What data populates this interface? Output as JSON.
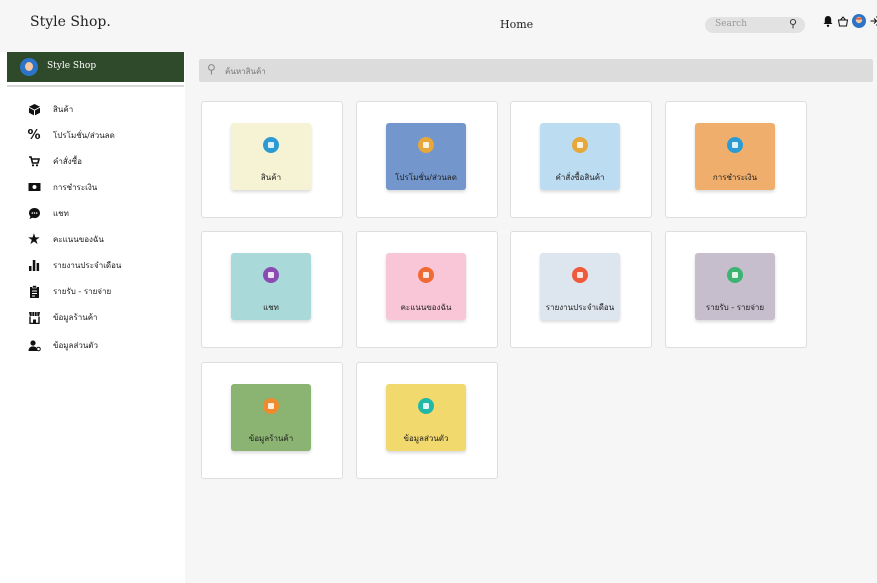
{
  "header": {
    "brand": "Style Shop.",
    "title": "Home",
    "search_placeholder": "Search"
  },
  "sidebar": {
    "title": "Style Shop",
    "items": [
      {
        "label": "สินค้า",
        "icon": "box-icon"
      },
      {
        "label": "โปรโมชั่น/ส่วนลด",
        "icon": "percent-icon"
      },
      {
        "label": "คำสั่งซื้อ",
        "icon": "cart-icon"
      },
      {
        "label": "การชำระเงิน",
        "icon": "money-icon"
      },
      {
        "label": "แชท",
        "icon": "chat-icon"
      },
      {
        "label": "คะแนนของฉัน",
        "icon": "star-icon"
      },
      {
        "label": "รายงานประจำเดือน",
        "icon": "bar-chart-icon"
      },
      {
        "label": "รายรับ - รายจ่าย",
        "icon": "clipboard-icon"
      },
      {
        "label": "ข้อมูลร้านค้า",
        "icon": "store-icon"
      },
      {
        "label": "ข้อมูลส่วนตัว",
        "icon": "user-settings-icon"
      }
    ]
  },
  "main": {
    "search_placeholder": "ค้นหาสินค้า",
    "cards": [
      {
        "label": "สินค้า",
        "color": "#f5f3d3",
        "icon_color": "#2d9bd3"
      },
      {
        "label": "โปรโมชั่น/ส่วนลด",
        "color": "#7397cc",
        "icon_color": "#e6a83a"
      },
      {
        "label": "คำสั่งซื้อสินค้า",
        "color": "#bcdcf1",
        "icon_color": "#e6a83a"
      },
      {
        "label": "การชำระเงิน",
        "color": "#f0ae6c",
        "icon_color": "#2d9bd3"
      },
      {
        "label": "แชท",
        "color": "#a9d9d8",
        "icon_color": "#8a4bb3"
      },
      {
        "label": "คะแนนของฉัน",
        "color": "#f9c6d8",
        "icon_color": "#ef6b35"
      },
      {
        "label": "รายงานประจำเดือน",
        "color": "#dde5ee",
        "icon_color": "#ef5a3a"
      },
      {
        "label": "รายรับ - รายจ่าย",
        "color": "#c6bdcd",
        "icon_color": "#3cb371"
      },
      {
        "label": "ข้อมูลร้านค้า",
        "color": "#8bb372",
        "icon_color": "#ef8a2e"
      },
      {
        "label": "ข้อมูลส่วนตัว",
        "color": "#f2d96d",
        "icon_color": "#22b8a8"
      }
    ]
  }
}
